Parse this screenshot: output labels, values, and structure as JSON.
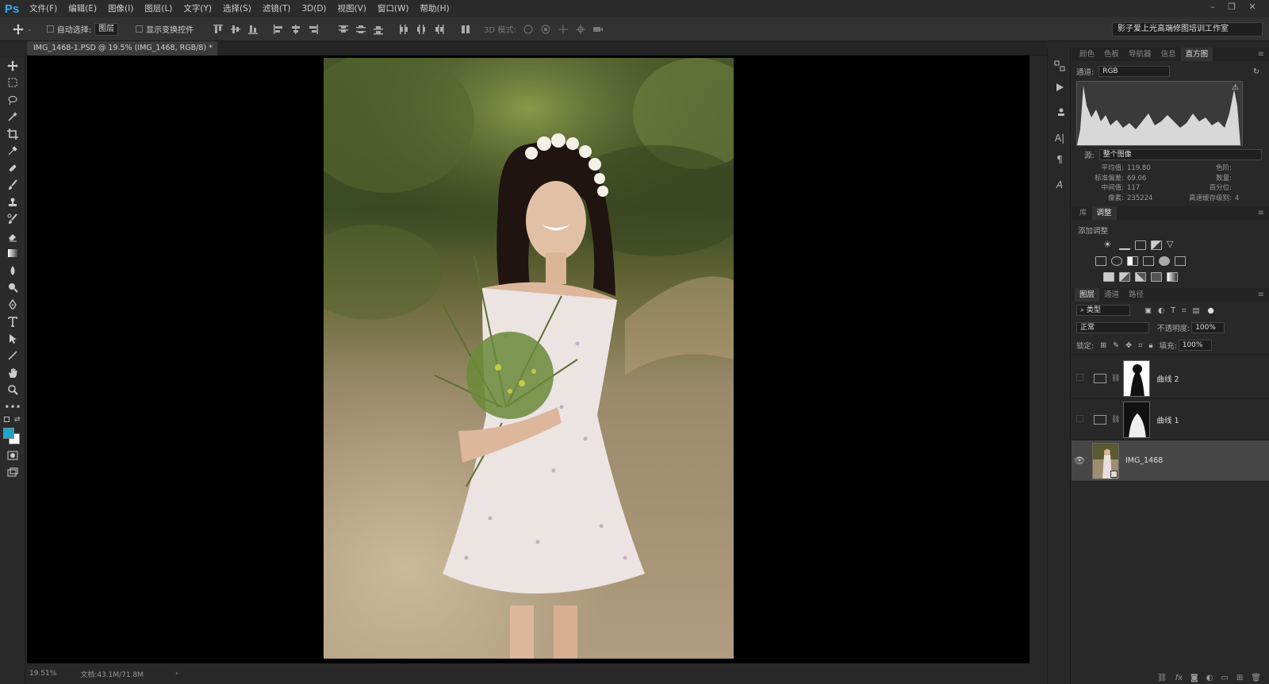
{
  "app": {
    "logo": "Ps"
  },
  "menu": [
    "文件(F)",
    "编辑(E)",
    "图像(I)",
    "图层(L)",
    "文字(Y)",
    "选择(S)",
    "滤镜(T)",
    "3D(D)",
    "视图(V)",
    "窗口(W)",
    "帮助(H)"
  ],
  "options": {
    "auto_select_label": "自动选择:",
    "auto_select_value": "图层",
    "show_transform_label": "显示变换控件",
    "mode_3d_label": "3D 模式:",
    "workspace": "影子爱上光高端修图培训工作室"
  },
  "document": {
    "tab_title": "IMG_1468-1.PSD @ 19.5% (IMG_1468, RGB/8) *",
    "tab_close": "×"
  },
  "status": {
    "zoom": "19.51%",
    "doc_size": "文档:43.1M/71.8M",
    "arrow": "›"
  },
  "histogram": {
    "tabs": [
      "颜色",
      "色板",
      "导航器",
      "信息",
      "直方图"
    ],
    "active_tab": "直方图",
    "channel_label": "通道:",
    "channel_value": "RGB",
    "source_label": "源:",
    "source_value": "整个图像",
    "stats": {
      "mean_label": "平均值:",
      "mean": "119.80",
      "std_label": "标准偏差:",
      "std": "69.06",
      "median_label": "中间值:",
      "median": "117",
      "pixels_label": "像素:",
      "pixels": "235224",
      "level_label": "色阶:",
      "count_label": "数量:",
      "percentile_label": "百分位:",
      "cache_label": "高速缓存级别:",
      "cache": "4"
    }
  },
  "adjustments": {
    "tabs": [
      "库",
      "调整"
    ],
    "active_tab": "调整",
    "add_label": "添加调整"
  },
  "layers_panel": {
    "tabs": [
      "图层",
      "通道",
      "路径"
    ],
    "filter_value": "类型",
    "blend_mode": "正常",
    "opacity_label": "不透明度:",
    "opacity": "100%",
    "lock_label": "锁定:",
    "fill_label": "填充:",
    "fill": "100%",
    "layers": [
      {
        "name": "曲线 2",
        "visible": false
      },
      {
        "name": "曲线 1",
        "visible": false
      },
      {
        "name": "IMG_1468",
        "visible": true
      }
    ]
  },
  "colors": {
    "foreground": "#1ea5c8",
    "background": "#ffffff"
  }
}
